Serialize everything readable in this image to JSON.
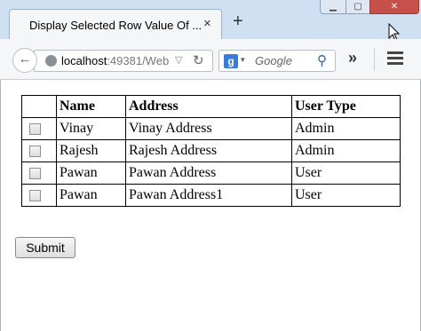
{
  "browser": {
    "tab_title": "Display Selected Row Value Of ...",
    "tab_close": "×",
    "new_tab": "+",
    "url_host": "localhost",
    "url_rest": ":49381/Web",
    "search_engine_icon": "g",
    "search_placeholder": "Google",
    "overflow": "»"
  },
  "table": {
    "headers": [
      "",
      "Name",
      "Address",
      "User Type"
    ],
    "rows": [
      {
        "name": "Vinay",
        "address": "Vinay Address",
        "user_type": "Admin"
      },
      {
        "name": "Rajesh",
        "address": "Rajesh Address",
        "user_type": "Admin"
      },
      {
        "name": "Pawan",
        "address": "Pawan Address",
        "user_type": "User"
      },
      {
        "name": "Pawan",
        "address": "Pawan Address1",
        "user_type": "User"
      }
    ]
  },
  "form": {
    "submit_label": "Submit"
  }
}
